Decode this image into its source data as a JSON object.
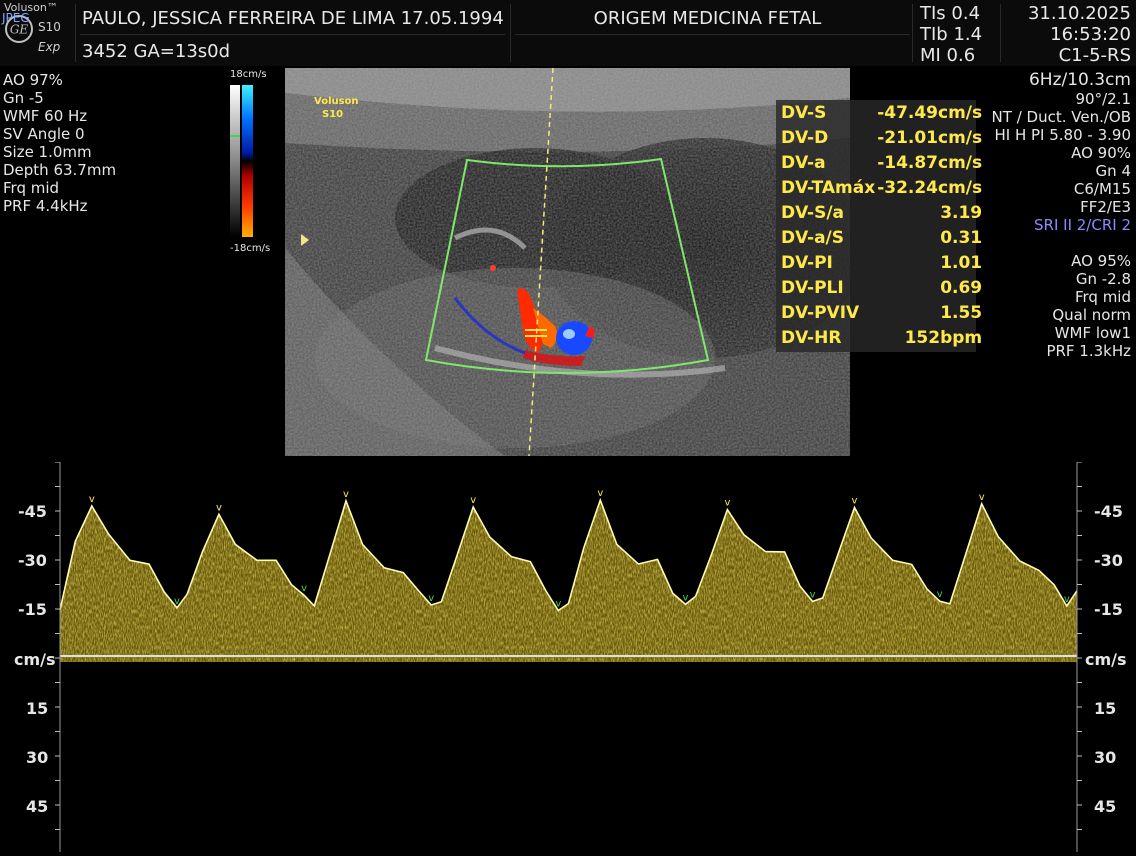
{
  "header": {
    "logo_brand": "Voluson™",
    "logo_jpeg": "JPEG",
    "logo_model": "S10",
    "logo_exp": "Exp",
    "patient": "PAULO, JESSICA FERREIRA DE LIMA  17.05.1994",
    "id_ga": "3452   GA=13s0d",
    "institution": "ORIGEM MEDICINA FETAL",
    "tis": "TIs  0.4",
    "tib": "TIb  1.4",
    "mi": "MI  0.6",
    "date": "31.10.2025",
    "time": "16:53:20",
    "probe": "C1-5-RS"
  },
  "left_params": [
    "AO 97%",
    "Gn  -5",
    "WMF 60 Hz",
    "SV Angle  0",
    "Size  1.0mm",
    "Depth 63.7mm",
    "Frq mid",
    "PRF  4.4kHz"
  ],
  "colorbar": {
    "top": "18cm/s",
    "bottom": "-18cm/s"
  },
  "image_logo": {
    "line1": "Voluson",
    "line2": "S10"
  },
  "right_params_1": [
    "6Hz/10.3cm",
    "90°/2.1",
    "NT / Duct. Ven./OB",
    "HI H PI 5.80 - 3.90",
    "AO 90%",
    "Gn   4",
    "C6/M15",
    "FF2/E3"
  ],
  "right_params_sri": "SRI II 2/CRI 2",
  "right_params_2": [
    "AO 95%",
    "Gn -2.8",
    "Frq mid",
    "Qual norm",
    "WMF low1",
    "PRF  1.3kHz"
  ],
  "measurements": [
    {
      "label": "DV-S",
      "value": "-47.49cm/s"
    },
    {
      "label": "DV-D",
      "value": "-21.01cm/s"
    },
    {
      "label": "DV-a",
      "value": "-14.87cm/s"
    },
    {
      "label": "DV-TAmáx",
      "value": "-32.24cm/s"
    },
    {
      "label": "DV-S/a",
      "value": "3.19"
    },
    {
      "label": "DV-a/S",
      "value": "0.31"
    },
    {
      "label": "DV-PI",
      "value": "1.01"
    },
    {
      "label": "DV-PLI",
      "value": "0.69"
    },
    {
      "label": "DV-PVIV",
      "value": "1.55"
    },
    {
      "label": "DV-HR",
      "value": "152bpm"
    }
  ],
  "doppler_scale": {
    "top_labels": [
      "-45",
      "-30",
      "-15"
    ],
    "unit": "cm/s",
    "bottom_labels": [
      "15",
      "30",
      "45"
    ]
  },
  "colors": {
    "measurement": "#ffe94a",
    "sri": "#8a8aff",
    "trace": "#fffbb0",
    "spectrum": "#b8a01a",
    "sector": "#7ee86a"
  }
}
